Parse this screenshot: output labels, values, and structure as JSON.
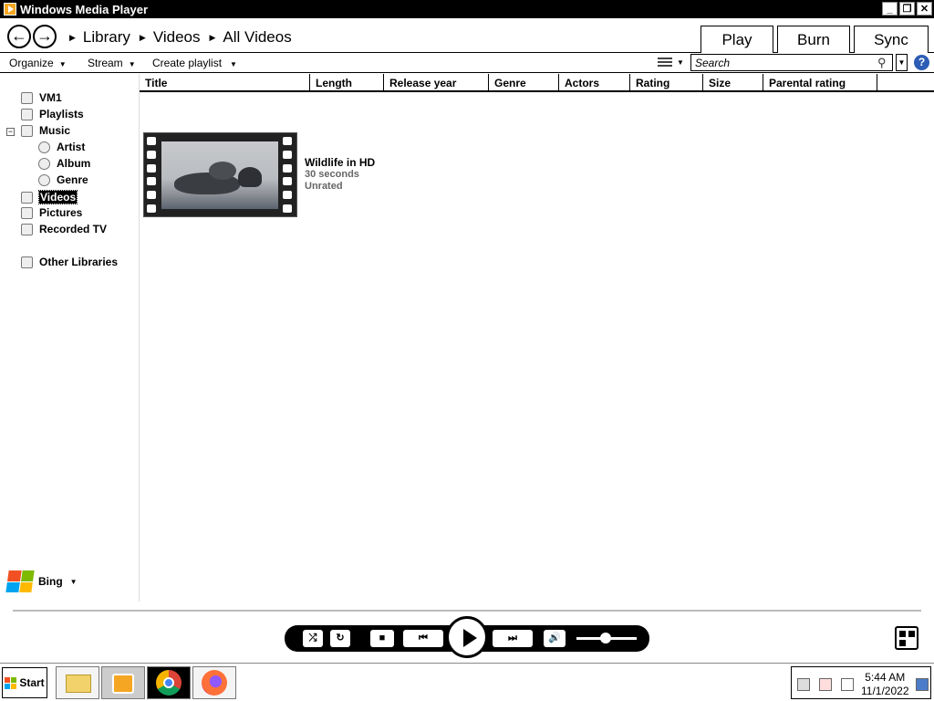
{
  "window": {
    "title": "Windows Media Player"
  },
  "nav": {
    "breadcrumbs": [
      "Library",
      "Videos",
      "All Videos"
    ],
    "tabs": [
      "Play",
      "Burn",
      "Sync"
    ]
  },
  "toolbar": {
    "organize": "Organize",
    "stream": "Stream",
    "create_playlist": "Create playlist",
    "search_placeholder": "Search"
  },
  "sidebar": {
    "items": [
      "VM1",
      "Playlists",
      "Music",
      "Artist",
      "Album",
      "Genre",
      "Videos",
      "Pictures",
      "Recorded TV",
      "Other Libraries"
    ],
    "bing": "Bing"
  },
  "columns": [
    "Title",
    "Length",
    "Release year",
    "Genre",
    "Actors",
    "Rating",
    "Size",
    "Parental rating"
  ],
  "videos": [
    {
      "title": "Wildlife in HD",
      "length": "30 seconds",
      "rating": "Unrated"
    }
  ],
  "taskbar": {
    "start": "Start",
    "time": "5:44 AM",
    "date": "11/1/2022"
  },
  "colors": {
    "accent": "#000000",
    "help": "#2d5db5"
  }
}
